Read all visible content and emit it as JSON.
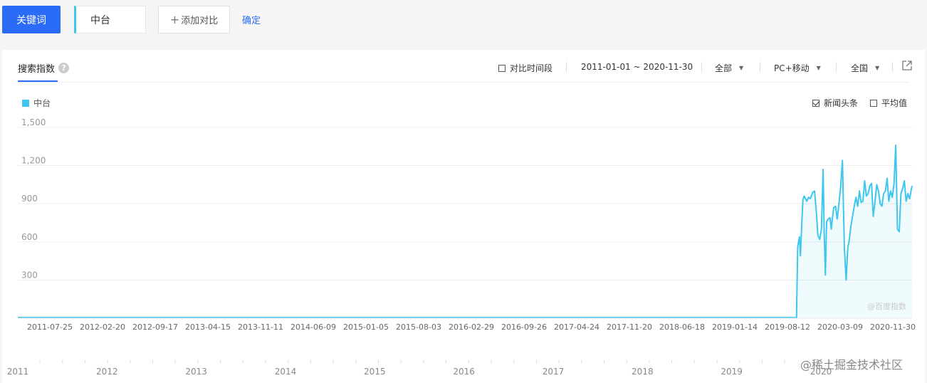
{
  "toolbar": {
    "keyword_button": "关键词",
    "keyword_value": "中台",
    "add_compare": "添加对比",
    "confirm": "确定"
  },
  "panel": {
    "tab_title": "搜索指数",
    "compare_period": "对比时间段",
    "date_range": "2011-01-01 ~ 2020-11-30",
    "scope": "全部",
    "device": "PC+移动",
    "region": "全国",
    "news_headline": "新闻头条",
    "average": "平均值"
  },
  "colors": {
    "accent": "#2a6cf6",
    "series": "#3ec6ee"
  },
  "watermark": "@百度指数",
  "corner_watermark": "@稀土掘金技术社区",
  "chart_data": {
    "type": "area",
    "series": [
      {
        "name": "中台",
        "x": [
          "2011-01-01",
          "2019-08-20",
          "2019-08-25",
          "2019-09-01",
          "2019-09-05",
          "2019-09-10",
          "2019-09-15",
          "2019-09-20",
          "2019-10-01",
          "2019-10-08",
          "2019-10-15",
          "2019-10-25",
          "2019-11-01",
          "2019-11-08",
          "2019-11-15",
          "2019-11-22",
          "2019-11-29",
          "2019-12-06",
          "2019-12-10",
          "2019-12-15",
          "2019-12-20",
          "2019-12-27",
          "2020-01-03",
          "2020-01-08",
          "2020-01-12",
          "2020-01-18",
          "2020-01-25",
          "2020-02-01",
          "2020-02-08",
          "2020-02-15",
          "2020-02-22",
          "2020-03-01",
          "2020-03-08",
          "2020-03-15",
          "2020-03-20",
          "2020-03-27",
          "2020-04-03",
          "2020-04-10",
          "2020-04-17",
          "2020-04-24",
          "2020-05-01",
          "2020-05-08",
          "2020-05-15",
          "2020-05-22",
          "2020-05-29",
          "2020-06-05",
          "2020-06-12",
          "2020-06-19",
          "2020-06-26",
          "2020-07-03",
          "2020-07-10",
          "2020-07-17",
          "2020-07-24",
          "2020-07-31",
          "2020-08-07",
          "2020-08-14",
          "2020-08-21",
          "2020-08-28",
          "2020-09-04",
          "2020-09-11",
          "2020-09-18",
          "2020-09-25",
          "2020-10-02",
          "2020-10-09",
          "2020-10-16",
          "2020-10-23",
          "2020-10-30",
          "2020-11-06",
          "2020-11-13",
          "2020-11-20",
          "2020-11-30"
        ],
        "y": [
          5,
          5,
          560,
          640,
          490,
          730,
          930,
          960,
          920,
          950,
          940,
          990,
          1000,
          850,
          650,
          620,
          700,
          1170,
          700,
          340,
          760,
          780,
          790,
          700,
          780,
          870,
          880,
          780,
          900,
          1040,
          1240,
          550,
          300,
          560,
          600,
          720,
          800,
          880,
          950,
          880,
          1000,
          910,
          920,
          1080,
          960,
          980,
          1040,
          1060,
          800,
          920,
          1050,
          1000,
          900,
          880,
          980,
          1000,
          1100,
          920,
          1000,
          950,
          1060,
          1360,
          700,
          680,
          980,
          1020,
          1080,
          920,
          980,
          940,
          1040
        ]
      }
    ],
    "title": "",
    "xlabel": "",
    "ylabel": "",
    "xlim": [
      "2011-01-01",
      "2020-11-30"
    ],
    "ylim": [
      0,
      1550
    ],
    "yticks": [
      300,
      600,
      900,
      1200,
      1500
    ],
    "ytick_labels": [
      "300",
      "600",
      "900",
      "1,200",
      "1,500"
    ],
    "xticks": [
      "2011-07-25",
      "2012-02-20",
      "2012-09-17",
      "2013-04-15",
      "2013-11-11",
      "2014-06-09",
      "2015-01-05",
      "2015-08-03",
      "2016-02-29",
      "2016-09-26",
      "2017-04-24",
      "2017-11-20",
      "2018-06-18",
      "2019-01-14",
      "2019-08-12",
      "2020-03-09",
      "2020-11-30"
    ],
    "year_labels": [
      "2011",
      "2012",
      "2013",
      "2014",
      "2015",
      "2016",
      "2017",
      "2018",
      "2019",
      "2020"
    ],
    "grid": true,
    "legend": "top-left"
  }
}
